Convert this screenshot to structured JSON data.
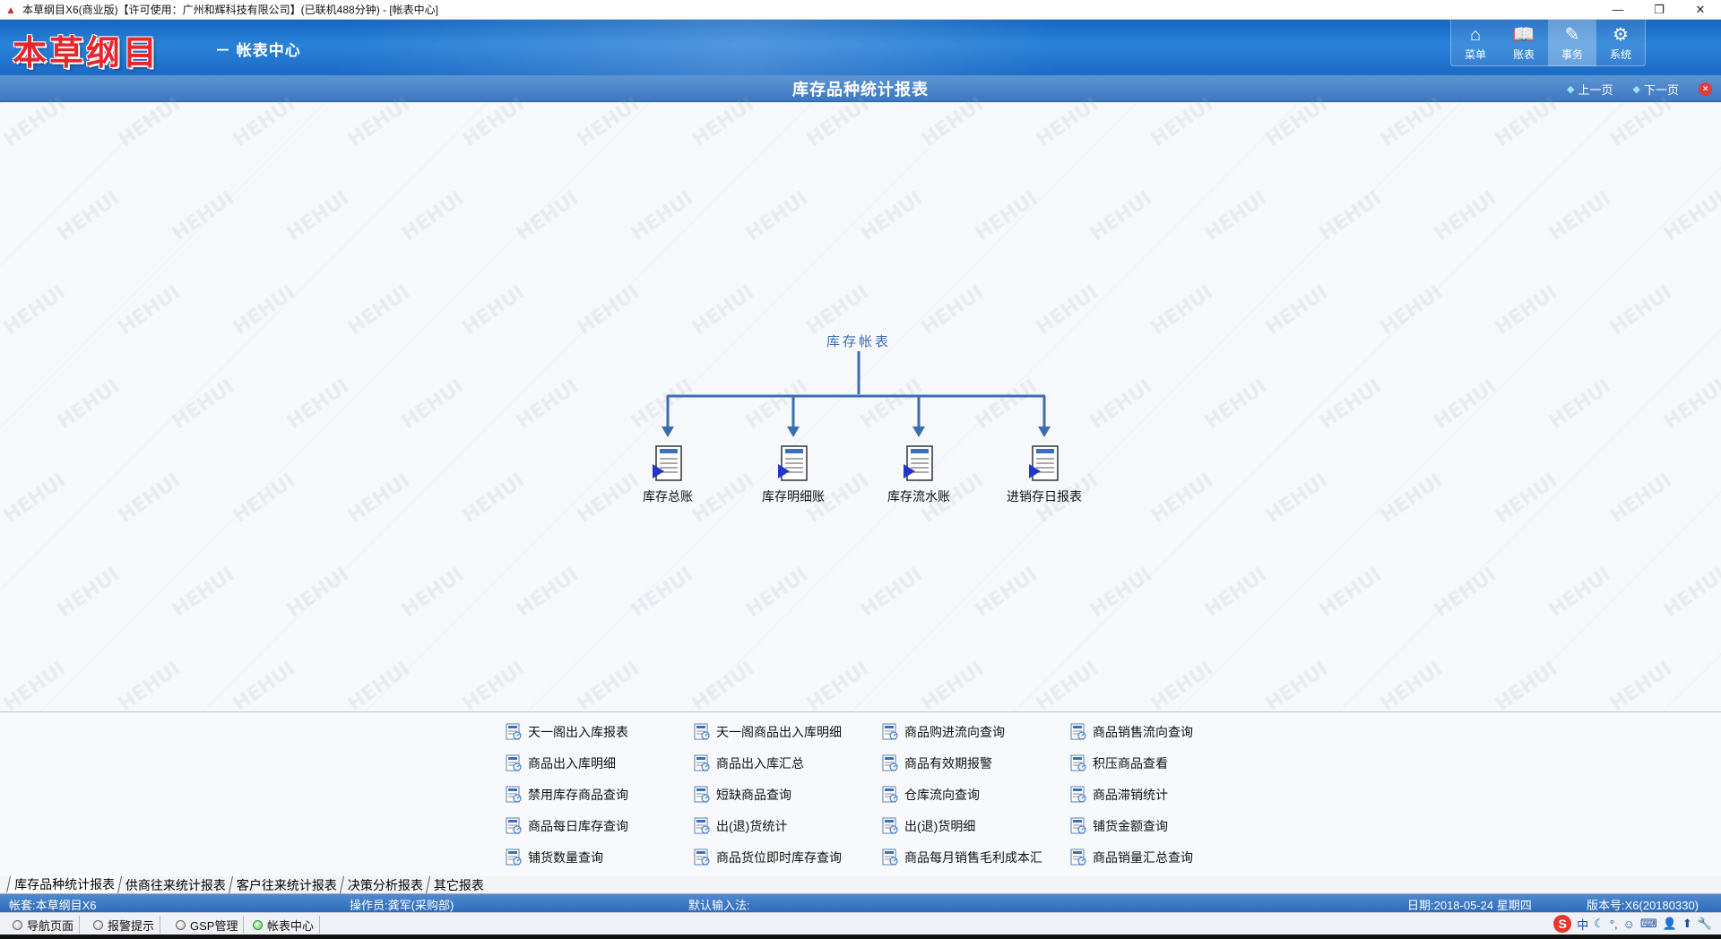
{
  "window": {
    "title": "本草纲目X6(商业版)【许可使用：广州和辉科技有限公司】(已联机488分钟) - [帐表中心]"
  },
  "header": {
    "logo": "本草纲目",
    "module_title": "－ 帐表中心",
    "nav": [
      {
        "label": "菜单",
        "icon": "home-icon",
        "glyph": "⌂"
      },
      {
        "label": "账表",
        "icon": "book-icon",
        "glyph": "📖"
      },
      {
        "label": "事务",
        "icon": "edit-icon",
        "glyph": "✎"
      },
      {
        "label": "系统",
        "icon": "gear-icon",
        "glyph": "⚙"
      }
    ],
    "active_nav": "事务"
  },
  "report": {
    "title": "库存品种统计报表",
    "prev": "上一页",
    "next": "下一页",
    "close": "×"
  },
  "tree": {
    "root": "库存帐表",
    "nodes": [
      "库存总账",
      "库存明细账",
      "库存流水账",
      "进销存日报表"
    ]
  },
  "links": [
    [
      "天一阁出入库报表",
      "天一阁商品出入库明细",
      "商品购进流向查询",
      "商品销售流向查询"
    ],
    [
      "商品出入库明细",
      "商品出入库汇总",
      "商品有效期报警",
      "积压商品查看"
    ],
    [
      "禁用库存商品查询",
      "短缺商品查询",
      "仓库流向查询",
      "商品滞销统计"
    ],
    [
      "商品每日库存查询",
      "出(退)货统计",
      "出(退)货明细",
      "铺货金额查询"
    ],
    [
      "铺货数量查询",
      "商品货位即时库存查询",
      "商品每月销售毛利成本汇",
      "商品销量汇总查询"
    ]
  ],
  "tabs": [
    "库存品种统计报表",
    "供商往来统计报表",
    "客户往来统计报表",
    "决策分析报表",
    "其它报表"
  ],
  "active_tab": "库存品种统计报表",
  "status": {
    "account": "帐套:本草纲目X6",
    "operator": "操作员:龚军(采购部)",
    "input_method": "默认输入法:",
    "date": "日期:2018-05-24 星期四",
    "version": "版本号:X6(20180330)"
  },
  "taskbar": {
    "buttons": [
      "导航页面",
      "报警提示",
      "GSP管理",
      "帐表中心"
    ],
    "active": "帐表中心",
    "tray": {
      "ime": "S",
      "lang": "中"
    }
  },
  "watermark": "HEHUI",
  "colors": {
    "header_blue": "#1b6ac6",
    "report_bar": "#3d78c0",
    "logo_red": "#e8252a",
    "tree_line": "#3c6ead"
  }
}
